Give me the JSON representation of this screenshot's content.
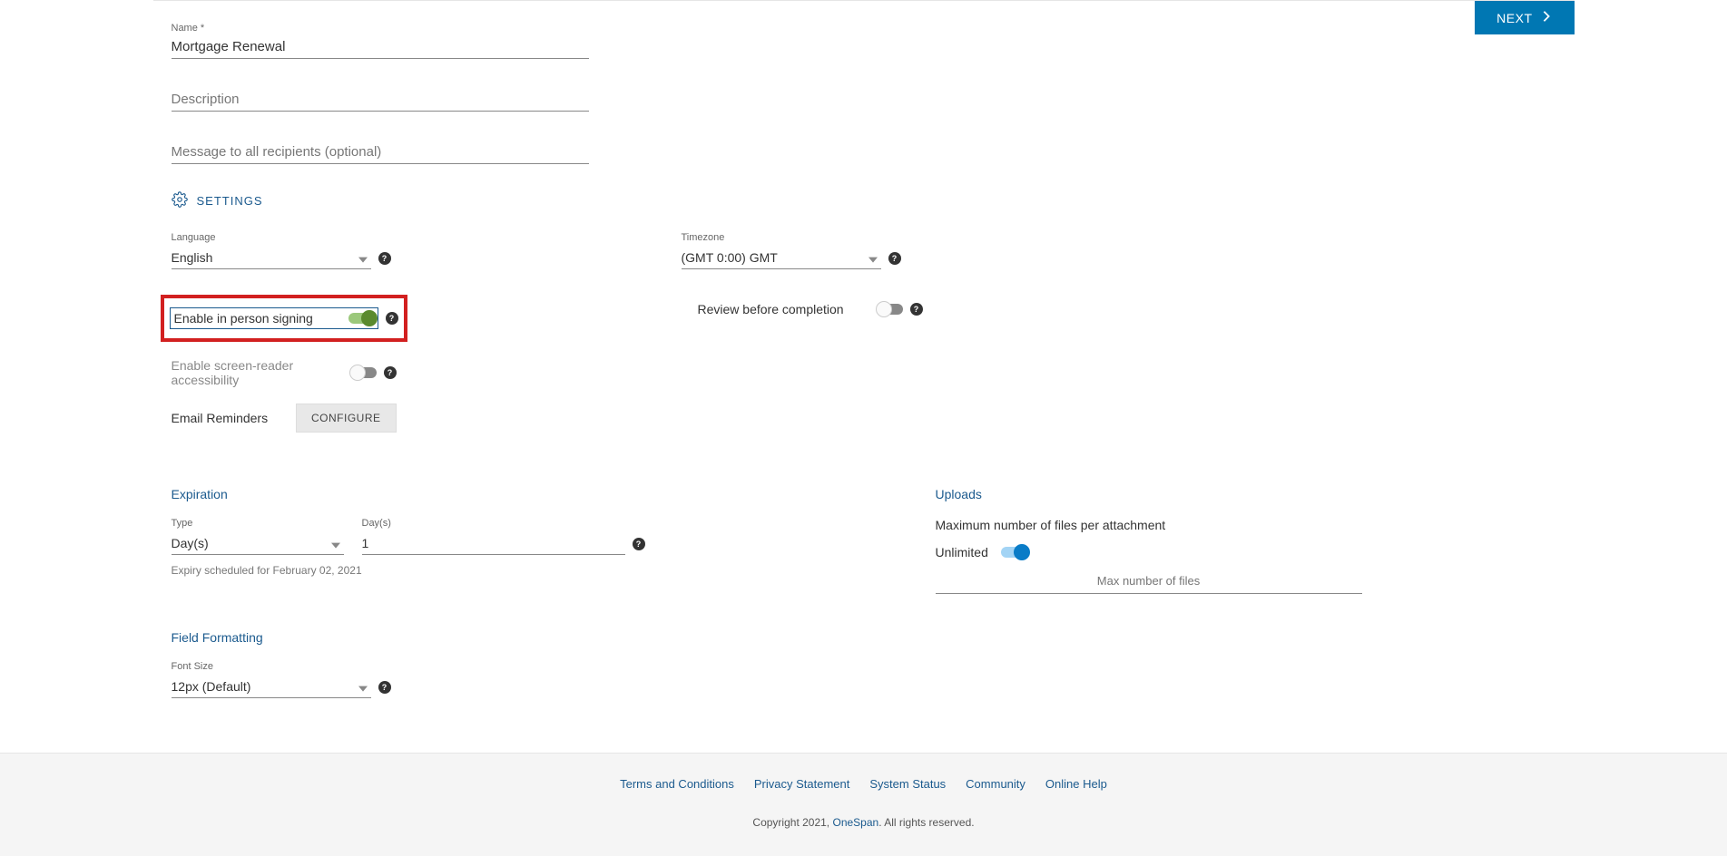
{
  "header": {
    "next_label": "NEXT"
  },
  "form": {
    "name_label": "Name *",
    "name_value": "Mortgage Renewal",
    "description_placeholder": "Description",
    "message_placeholder": "Message to all recipients (optional)"
  },
  "settings": {
    "header": "SETTINGS",
    "language_label": "Language",
    "language_value": "English",
    "timezone_label": "Timezone",
    "timezone_value": "(GMT 0:00) GMT",
    "in_person_label": "Enable in person signing",
    "screen_reader_label": "Enable screen-reader accessibility",
    "review_label": "Review before completion",
    "email_reminders_label": "Email Reminders",
    "configure_label": "CONFIGURE"
  },
  "expiration": {
    "title": "Expiration",
    "type_label": "Type",
    "type_value": "Day(s)",
    "days_label": "Day(s)",
    "days_value": "1",
    "schedule_text": "Expiry scheduled for February 02, 2021"
  },
  "uploads": {
    "title": "Uploads",
    "max_files_label": "Maximum number of files per attachment",
    "unlimited_label": "Unlimited",
    "max_number_placeholder": "Max number of files"
  },
  "field_formatting": {
    "title": "Field Formatting",
    "font_size_label": "Font Size",
    "font_size_value": "12px (Default)"
  },
  "footer": {
    "links": {
      "terms": "Terms and Conditions",
      "privacy": "Privacy Statement",
      "status": "System Status",
      "community": "Community",
      "help": "Online Help"
    },
    "copyright_prefix": "Copyright 2021, ",
    "copyright_brand": "OneSpan",
    "copyright_suffix": ". All rights reserved."
  }
}
